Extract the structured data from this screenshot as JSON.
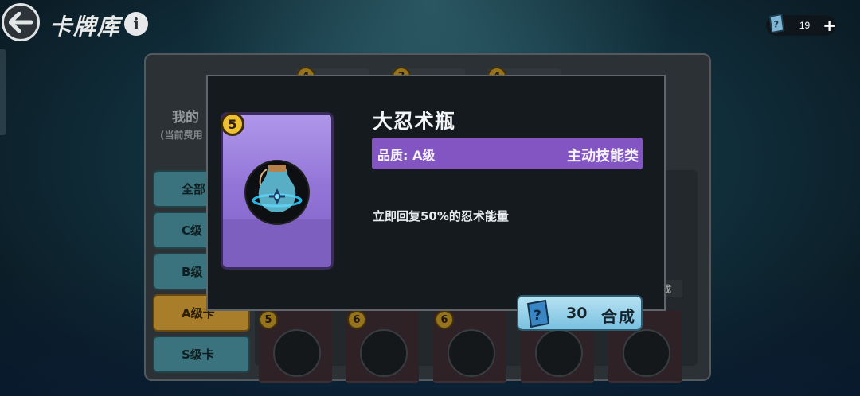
{
  "header": {
    "title": "卡牌库",
    "info_icon": "info-icon",
    "back_icon": "back-arrow-icon",
    "currency": {
      "icon": "card-ticket-icon",
      "value": "19",
      "plus": "+"
    }
  },
  "sidebar": {
    "deck_label": "我的",
    "deck_sub": "(当前费用",
    "tabs": [
      {
        "label": "全部"
      },
      {
        "label": "C级"
      },
      {
        "label": "B级"
      },
      {
        "label": "A级卡",
        "active": true
      },
      {
        "label": "S级卡"
      }
    ]
  },
  "grid": {
    "top_costs": [
      "4",
      "3",
      "4"
    ],
    "bottom_costs": [
      "5",
      "6",
      "6"
    ],
    "merge_small": "成"
  },
  "modal": {
    "card_cost": "5",
    "item_name": "大忍术瓶",
    "quality_label": "品质: A级",
    "quality_type": "主动技能类",
    "description": "立即回复50%的忍术能量",
    "merge_count": "30",
    "merge_label": "合成",
    "colors": {
      "quality_bar": "#8255c3",
      "card": "#9b7fe0",
      "merge_button": "#8fcde6"
    }
  }
}
